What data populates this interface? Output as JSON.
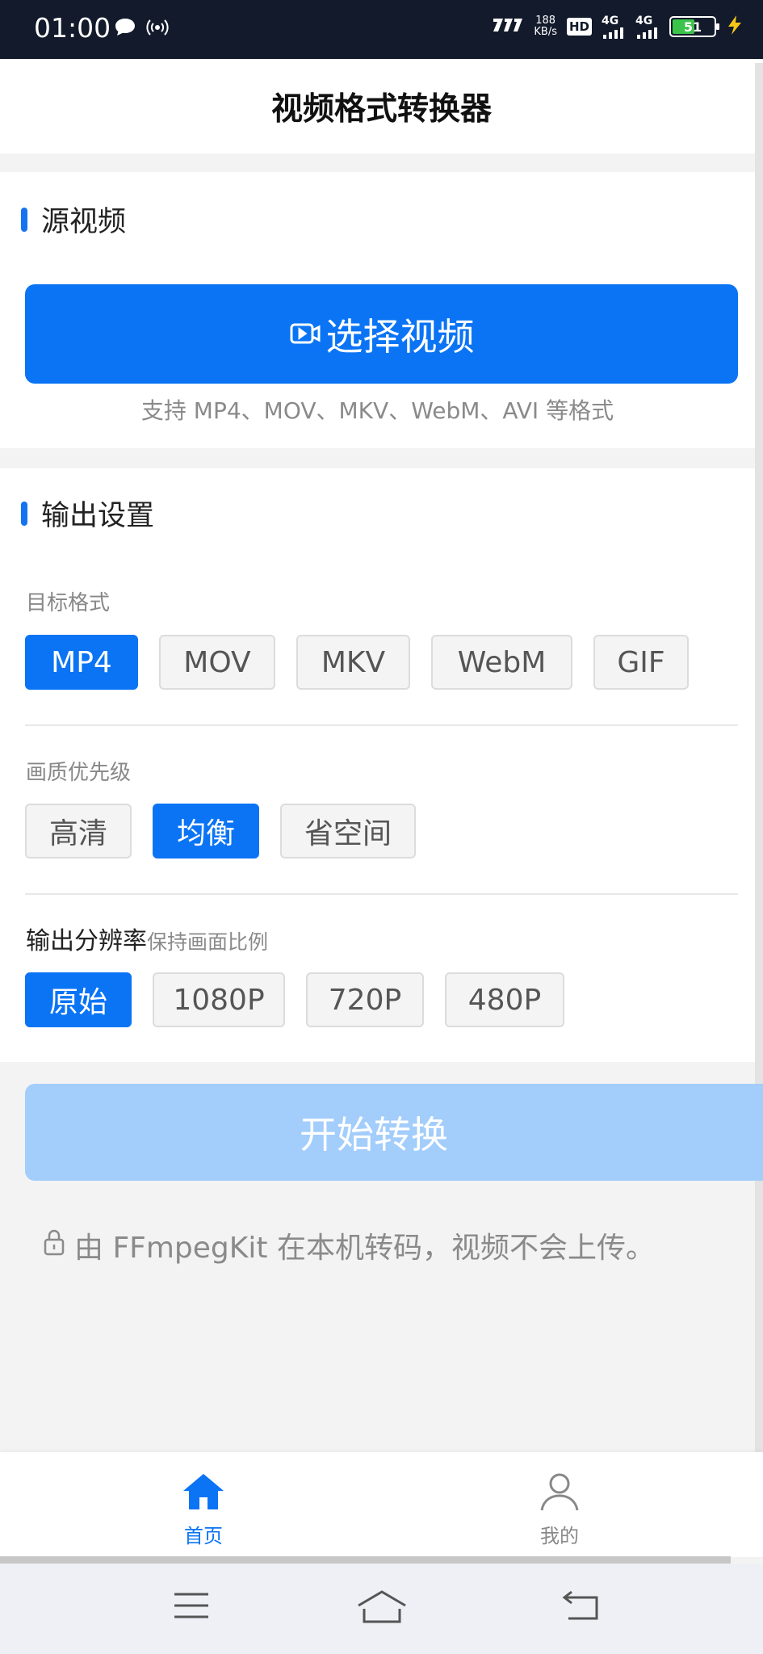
{
  "status_bar": {
    "time": "01:00",
    "net_speed_value": "188",
    "net_speed_unit": "KB/s",
    "hd_label": "HD",
    "signal1": "4G",
    "signal2": "4G",
    "battery": "51"
  },
  "header": {
    "title": "视频格式转换器"
  },
  "source": {
    "title": "源视频",
    "select_label": "选择视频",
    "hint": "支持 MP4、MOV、MKV、WebM、AVI 等格式"
  },
  "output": {
    "title": "输出设置",
    "format_label": "目标格式",
    "formats": [
      "MP4",
      "MOV",
      "MKV",
      "WebM",
      "GIF"
    ],
    "format_selected": "MP4",
    "quality_label": "画质优先级",
    "qualities": [
      "高清",
      "均衡",
      "省空间"
    ],
    "quality_selected": "均衡",
    "resolution_label": "输出分辨率",
    "resolution_sub": "保持画面比例",
    "resolutions": [
      "原始",
      "1080P",
      "720P",
      "480P"
    ],
    "resolution_selected": "原始"
  },
  "actions": {
    "start_label": "开始转换"
  },
  "note": "由 FFmpegKit 在本机转码，视频不会上传。",
  "tabbar": {
    "home": "首页",
    "me": "我的"
  },
  "colors": {
    "accent": "#0a74f5",
    "accent_disabled": "#a3cdfb"
  }
}
